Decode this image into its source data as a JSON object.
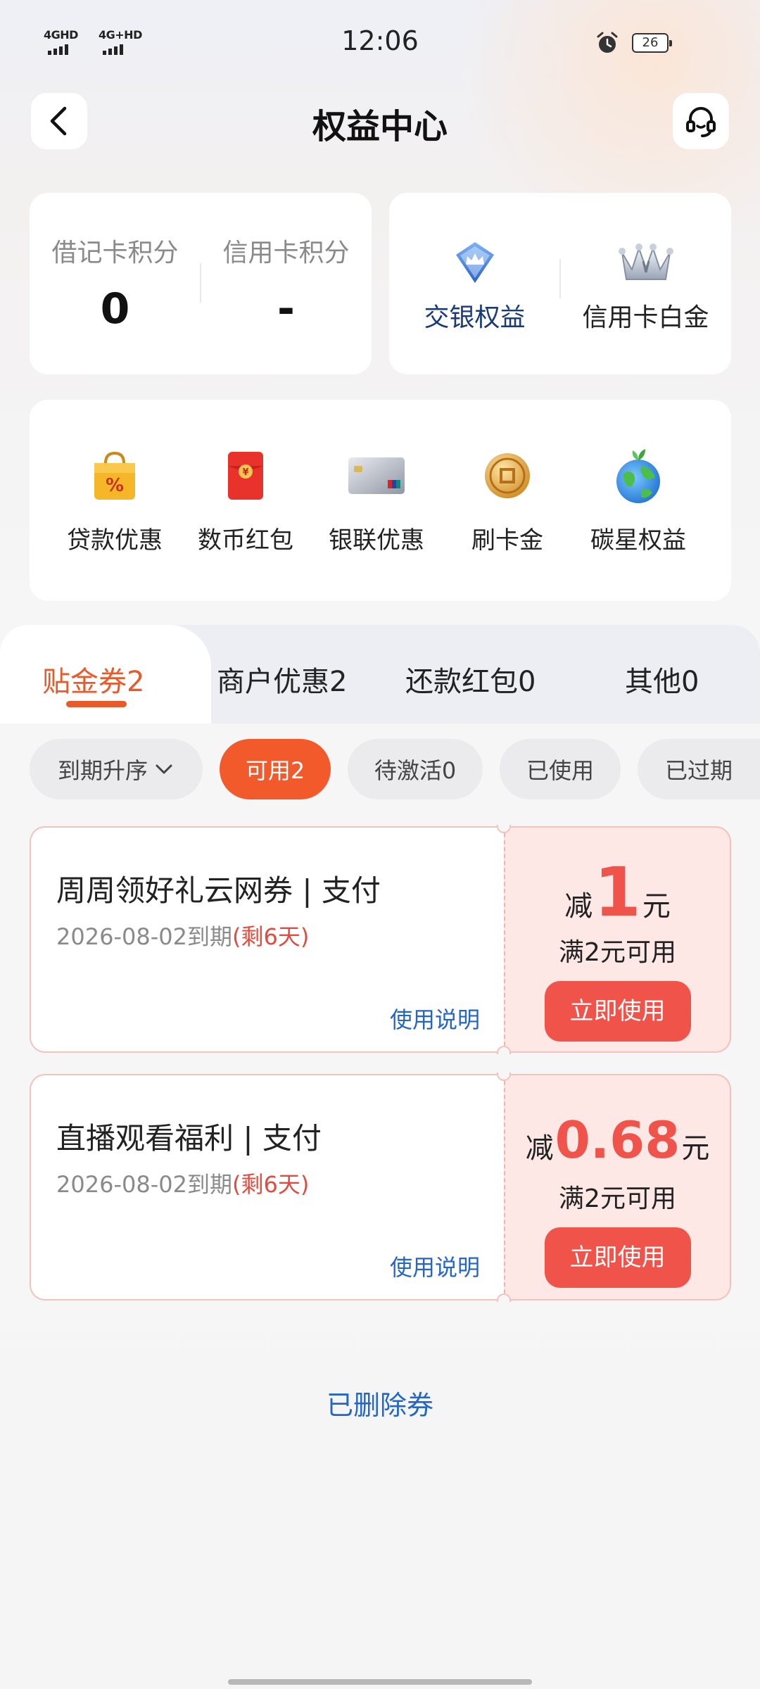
{
  "status": {
    "net1": "4GHD",
    "net2": "4G+HD",
    "time": "12:06",
    "battery": "26"
  },
  "nav": {
    "title": "权益中心"
  },
  "points": {
    "debit_label": "借记卡积分",
    "debit_value": "0",
    "credit_label": "信用卡积分",
    "credit_value": "-"
  },
  "benefits": {
    "boc_label": "交银权益",
    "platinum_label": "信用卡白金"
  },
  "quick": [
    {
      "label": "贷款优惠",
      "icon": "shopping-bag-icon"
    },
    {
      "label": "数币红包",
      "icon": "red-envelope-icon"
    },
    {
      "label": "银联优惠",
      "icon": "unionpay-card-icon"
    },
    {
      "label": "刷卡金",
      "icon": "gold-coin-icon"
    },
    {
      "label": "碳星权益",
      "icon": "earth-icon"
    }
  ],
  "tabs": [
    {
      "label": "贴金券2",
      "active": true
    },
    {
      "label": "商户优惠2"
    },
    {
      "label": "还款红包0"
    },
    {
      "label": "其他0"
    }
  ],
  "filters": {
    "sort": "到期升序",
    "available": "可用2",
    "pending": "待激活0",
    "used": "已使用",
    "expired": "已过期"
  },
  "coupons": [
    {
      "name": "周周领好礼云网券 | 支付",
      "expiry": "2026-08-02到期",
      "remaining": "(剩6天)",
      "guide": "使用说明",
      "prefix": "减",
      "amount": "1",
      "unit": "元",
      "condition": "满2元可用",
      "button": "立即使用"
    },
    {
      "name": "直播观看福利 | 支付",
      "expiry": "2026-08-02到期",
      "remaining": "(剩6天)",
      "guide": "使用说明",
      "prefix": "减",
      "amount": "0.68",
      "unit": "元",
      "condition": "满2元可用",
      "button": "立即使用"
    }
  ],
  "footer": {
    "deleted": "已删除券"
  },
  "colors": {
    "accent_orange": "#f25a2b",
    "coupon_red": "#f0534a",
    "link_blue": "#2466c8"
  }
}
